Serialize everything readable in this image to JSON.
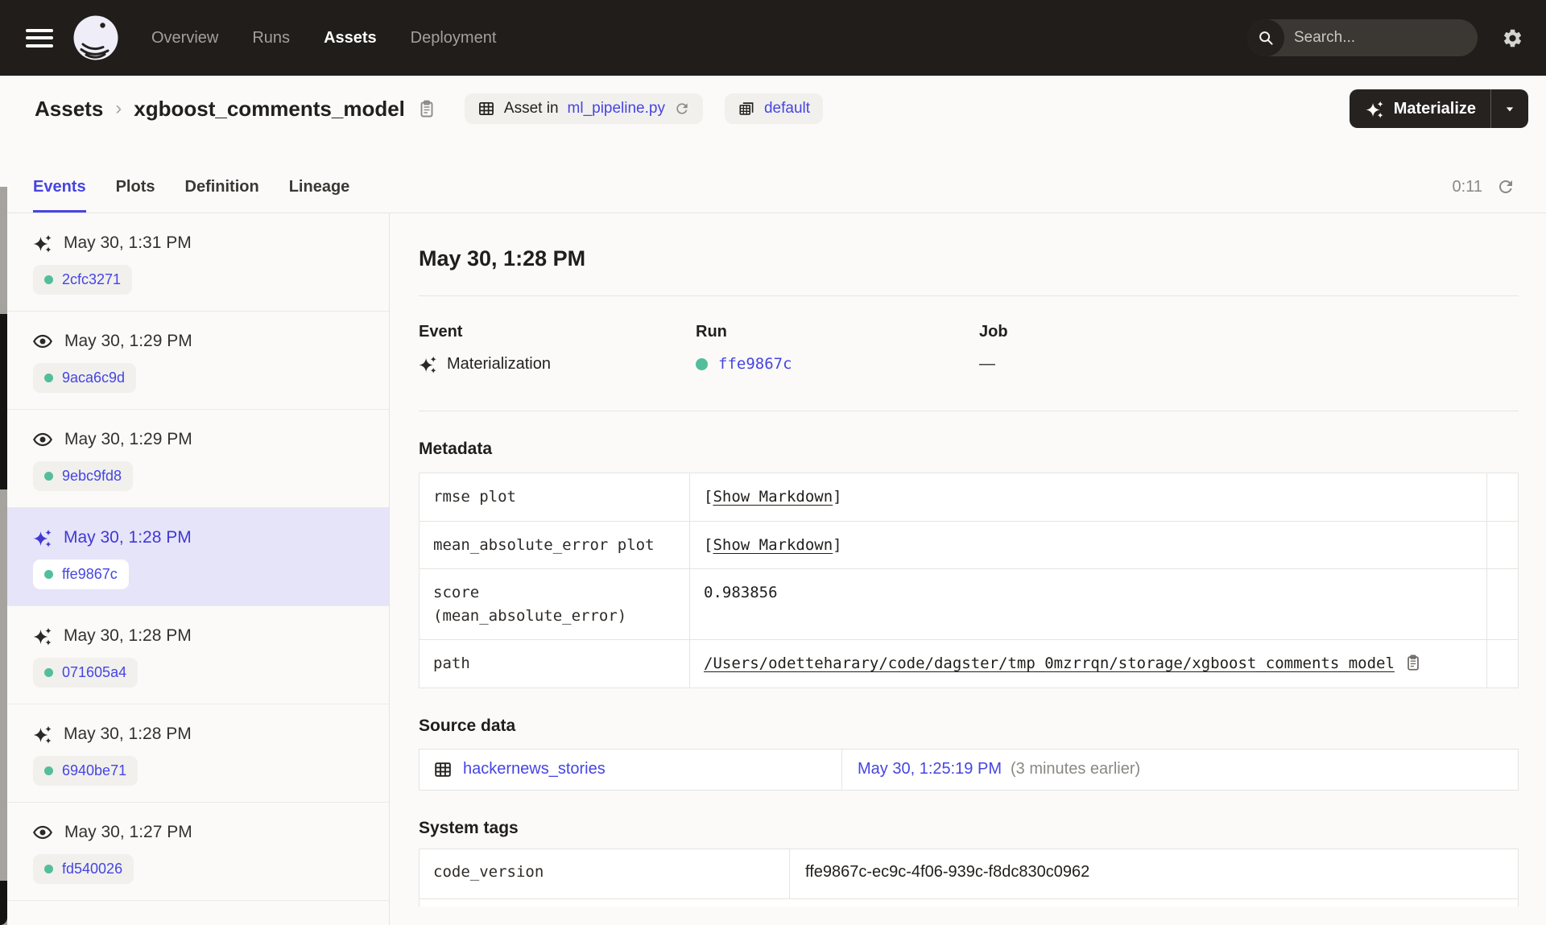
{
  "nav": {
    "links": [
      {
        "label": "Overview",
        "active": false
      },
      {
        "label": "Runs",
        "active": false
      },
      {
        "label": "Assets",
        "active": true
      },
      {
        "label": "Deployment",
        "active": false
      }
    ],
    "search_placeholder": "Search...",
    "search_shortcut": "/"
  },
  "header": {
    "breadcrumb": {
      "root": "Assets",
      "separator": "›",
      "current": "xgboost_comments_model"
    },
    "asset_location": {
      "prefix": "Asset in",
      "file": "ml_pipeline.py"
    },
    "repo_name": "default",
    "materialize_label": "Materialize"
  },
  "tabs": {
    "items": [
      {
        "label": "Events",
        "active": true
      },
      {
        "label": "Plots",
        "active": false
      },
      {
        "label": "Definition",
        "active": false
      },
      {
        "label": "Lineage",
        "active": false
      }
    ],
    "refresh_timer": "0:11"
  },
  "sidebar": {
    "events": [
      {
        "type": "materialization",
        "timestamp": "May 30, 1:31 PM",
        "run_id": "2cfc3271",
        "selected": false
      },
      {
        "type": "observation",
        "timestamp": "May 30, 1:29 PM",
        "run_id": "9aca6c9d",
        "selected": false
      },
      {
        "type": "observation",
        "timestamp": "May 30, 1:29 PM",
        "run_id": "9ebc9fd8",
        "selected": false
      },
      {
        "type": "materialization",
        "timestamp": "May 30, 1:28 PM",
        "run_id": "ffe9867c",
        "selected": true
      },
      {
        "type": "materialization",
        "timestamp": "May 30, 1:28 PM",
        "run_id": "071605a4",
        "selected": false
      },
      {
        "type": "materialization",
        "timestamp": "May 30, 1:28 PM",
        "run_id": "6940be71",
        "selected": false
      },
      {
        "type": "observation",
        "timestamp": "May 30, 1:27 PM",
        "run_id": "fd540026",
        "selected": false
      }
    ]
  },
  "detail": {
    "title": "May 30, 1:28 PM",
    "event_label": "Event",
    "event_value": "Materialization",
    "run_label": "Run",
    "run_value": "ffe9867c",
    "job_label": "Job",
    "job_value": "—",
    "metadata": {
      "heading": "Metadata",
      "bracket_open": "[",
      "bracket_close": "]",
      "rows": [
        {
          "key": "rmse plot",
          "value": "Show Markdown",
          "value_type": "markdown_link"
        },
        {
          "key": "mean_absolute_error plot",
          "value": "Show Markdown",
          "value_type": "markdown_link"
        },
        {
          "key": "score\n(mean_absolute_error)",
          "value": "0.983856",
          "value_type": "text"
        },
        {
          "key": "path",
          "value": "/Users/odetteharary/code/dagster/tmp_0mzrrqn/storage/xgboost_comments_model",
          "value_type": "path_link"
        }
      ]
    },
    "source_data": {
      "heading": "Source data",
      "asset_name": "hackernews_stories",
      "timestamp": "May 30, 1:25:19 PM",
      "relative_time": "(3 minutes earlier)"
    },
    "system_tags": {
      "heading": "System tags",
      "rows": [
        {
          "key": "code_version",
          "value": "ffe9867c-ec9c-4f06-939c-f8dc830c0962"
        }
      ]
    }
  },
  "colors": {
    "accent": "#4645E2",
    "success_green": "#53BE9B",
    "nav_bg": "#201D1A",
    "selected_row_bg": "#E6E4F8"
  }
}
